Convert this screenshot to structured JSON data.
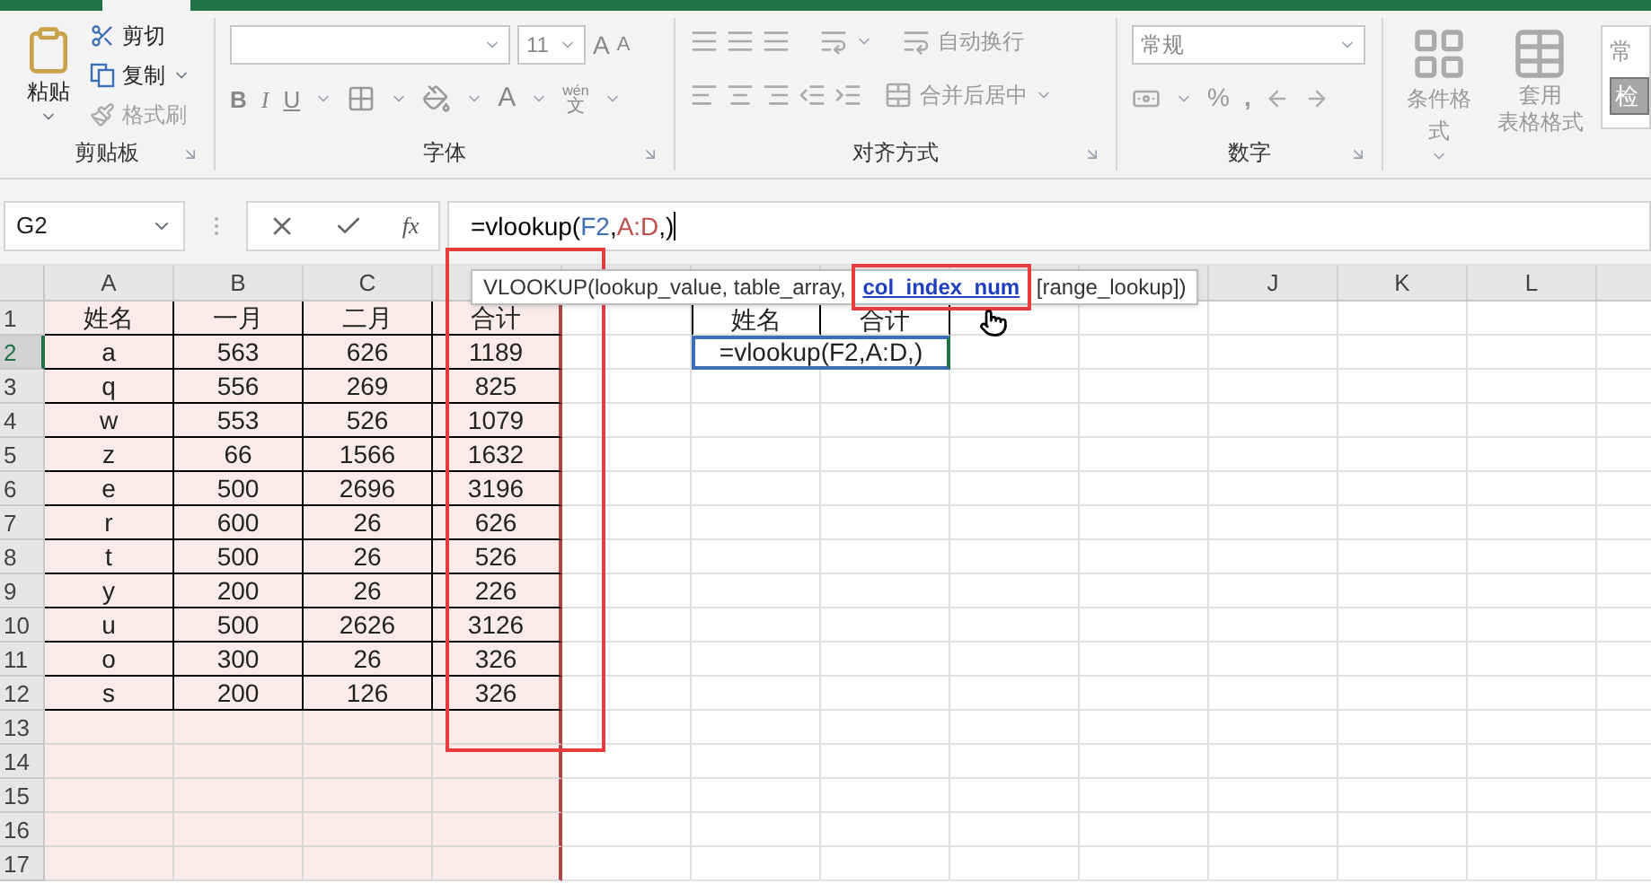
{
  "ribbon": {
    "clipboard": {
      "label": "剪贴板",
      "paste": "粘贴",
      "items": [
        {
          "label": "剪切",
          "kind": "cut",
          "disabled": false,
          "dropdown": false
        },
        {
          "label": "复制",
          "kind": "copy",
          "disabled": false,
          "dropdown": true
        },
        {
          "label": "格式刷",
          "kind": "painter",
          "disabled": true,
          "dropdown": false
        }
      ]
    },
    "font": {
      "label": "字体",
      "size": "11",
      "grow": "A",
      "shrink": "A",
      "bold": "B",
      "italic": "I",
      "underline": "U",
      "font_color": "A",
      "phonetic_top": "wén",
      "phonetic_bottom": "文"
    },
    "alignment": {
      "label": "对齐方式",
      "wrap": "自动换行",
      "merge": "合并后居中"
    },
    "number": {
      "label": "数字",
      "format": "常规",
      "percent": "%",
      "comma": ","
    },
    "styles": {
      "conditional": "条件格式",
      "table_top": "套用",
      "table_bottom": "表格格式",
      "style_top": "常",
      "style_bottom": "检"
    }
  },
  "formula_bar": {
    "name_box": "G2",
    "fx": "fx",
    "parts": [
      {
        "text": "=vlookup(",
        "color": "#000000"
      },
      {
        "text": "F2",
        "color": "#3c6fb6",
        "after": ","
      },
      {
        "text": "A:D",
        "color": "#c0504d",
        "after": ",)"
      }
    ]
  },
  "tooltip": {
    "before": "VLOOKUP(lookup_value, table_array, ",
    "current": "col_index_num",
    "after": " [range_lookup])"
  },
  "column_headers_left": [
    "A",
    "B",
    "C"
  ],
  "column_headers_right": [
    "J",
    "K",
    "L"
  ],
  "rows": [
    {
      "number": "1",
      "cells": [
        "姓名",
        "一月",
        "二月",
        "合计"
      ]
    },
    {
      "number": "2",
      "cells": [
        "a",
        "563",
        "626",
        "1189"
      ]
    },
    {
      "number": "3",
      "cells": [
        "q",
        "556",
        "269",
        "825"
      ]
    },
    {
      "number": "4",
      "cells": [
        "w",
        "553",
        "526",
        "1079"
      ]
    },
    {
      "number": "5",
      "cells": [
        "z",
        "66",
        "1566",
        "1632"
      ]
    },
    {
      "number": "6",
      "cells": [
        "e",
        "500",
        "2696",
        "3196"
      ]
    },
    {
      "number": "7",
      "cells": [
        "r",
        "600",
        "26",
        "626"
      ]
    },
    {
      "number": "8",
      "cells": [
        "t",
        "500",
        "26",
        "526"
      ]
    },
    {
      "number": "9",
      "cells": [
        "y",
        "200",
        "26",
        "226"
      ]
    },
    {
      "number": "10",
      "cells": [
        "u",
        "500",
        "2626",
        "3126"
      ]
    },
    {
      "number": "11",
      "cells": [
        "o",
        "300",
        "26",
        "326"
      ]
    },
    {
      "number": "12",
      "cells": [
        "s",
        "200",
        "126",
        "326"
      ]
    },
    {
      "number": "13"
    },
    {
      "number": "14"
    },
    {
      "number": "15"
    },
    {
      "number": "16"
    },
    {
      "number": "17"
    }
  ],
  "lookup": {
    "headers": [
      "姓名",
      "合计"
    ],
    "editing_formula": "=vlookup(F2,A:D,)"
  }
}
